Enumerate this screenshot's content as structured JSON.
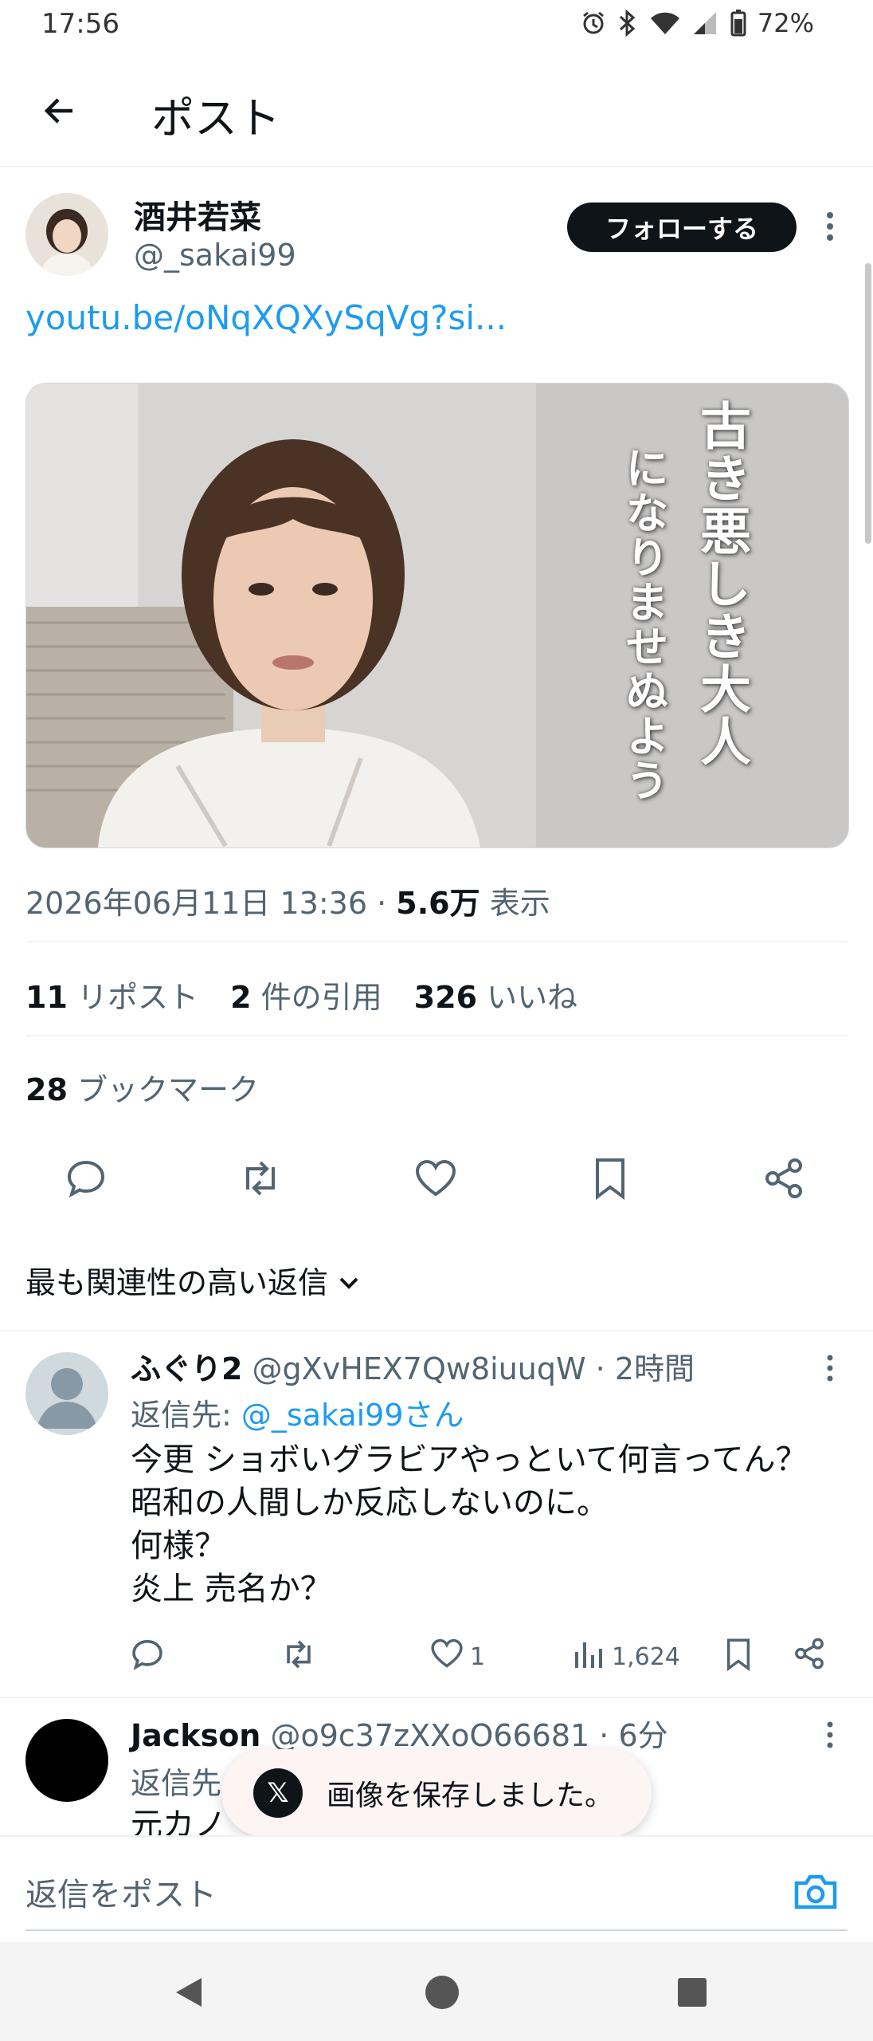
{
  "status_bar": {
    "time": "17:56",
    "battery": "72%"
  },
  "header": {
    "title": "ポスト"
  },
  "post": {
    "author_name": "酒井若菜",
    "author_handle": "@_sakai99",
    "follow_label": "フォローする",
    "link_text": "youtu.be/oNqXQXySqVg?si...",
    "media_overlay_line1": "古き悪しき大人",
    "media_overlay_line2": "になりませぬよう",
    "timestamp": "2026年06月11日 13:36",
    "separator": " · ",
    "views_count": "5.6万",
    "views_label": "表示",
    "reposts_count": "11",
    "reposts_label": "リポスト",
    "quotes_count": "2",
    "quotes_label": "件の引用",
    "likes_count": "326",
    "likes_label": "いいね",
    "bookmarks_count": "28",
    "bookmarks_label": "ブックマーク"
  },
  "actions": [
    "reply-icon",
    "repost-icon",
    "like-icon",
    "bookmark-icon",
    "share-icon"
  ],
  "sort": {
    "label": "最も関連性の高い返信"
  },
  "replies": [
    {
      "name": "ふぐり2",
      "handle": "@gXvHEX7Qw8iuuqW",
      "time": "2時間",
      "reply_to_label": "返信先:",
      "reply_to_handle": "@_sakai99さん",
      "body_line1": "今更 ショボいグラビアやっといて何言ってん？",
      "body_line2": "昭和の人間しか反応しないのに。",
      "body_line3": "何様？",
      "body_line4": "炎上 売名か？",
      "likes": "1",
      "views": "1,624"
    },
    {
      "name": "Jackson",
      "handle": "@o9c37zXXoO66681",
      "time": "6分",
      "reply_to_label": "返信先",
      "body_partial": "元カノ"
    }
  ],
  "toast": {
    "message": "画像を保存しました。"
  },
  "compose": {
    "placeholder": "返信をポスト"
  },
  "colors": {
    "link": "#1d9bf0",
    "text": "#0f1419",
    "secondary": "#536471"
  }
}
